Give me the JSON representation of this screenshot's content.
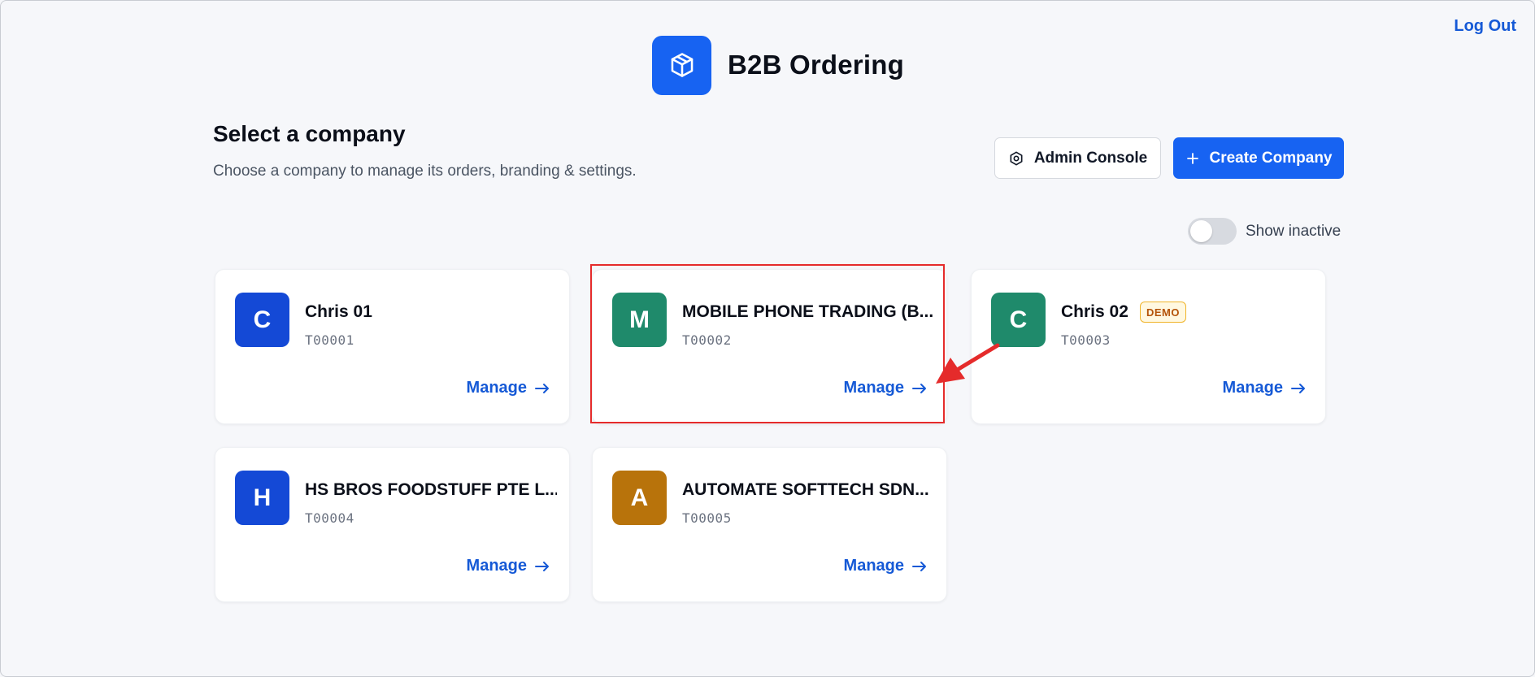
{
  "header": {
    "logout_label": "Log Out",
    "brand_title": "B2B Ordering",
    "brand_icon": "box-icon"
  },
  "page": {
    "title": "Select a company",
    "subtitle": "Choose a company to manage its orders, branding & settings."
  },
  "actions": {
    "admin_label": "Admin Console",
    "create_label": "Create Company"
  },
  "filter": {
    "show_inactive_label": "Show inactive",
    "show_inactive_on": false
  },
  "companies": [
    {
      "initial": "C",
      "name": "Chris 01",
      "code": "T00001",
      "color": "#1449d6",
      "badge": "",
      "action": "Manage"
    },
    {
      "initial": "M",
      "name": "MOBILE PHONE TRADING (B...",
      "code": "T00002",
      "color": "#1f8a6b",
      "badge": "",
      "action": "Manage"
    },
    {
      "initial": "C",
      "name": "Chris 02",
      "code": "T00003",
      "color": "#1f8a6b",
      "badge": "DEMO",
      "action": "Manage"
    },
    {
      "initial": "H",
      "name": "HS BROS FOODSTUFF PTE L...",
      "code": "T00004",
      "color": "#1449d6",
      "badge": "",
      "action": "Manage"
    },
    {
      "initial": "A",
      "name": "AUTOMATE SOFTTECH SDN...",
      "code": "T00005",
      "color": "#b8730b",
      "badge": "",
      "action": "Manage"
    }
  ],
  "colors": {
    "accent": "#1763f2",
    "link": "#1559d6",
    "highlight": "#e52b2b"
  }
}
